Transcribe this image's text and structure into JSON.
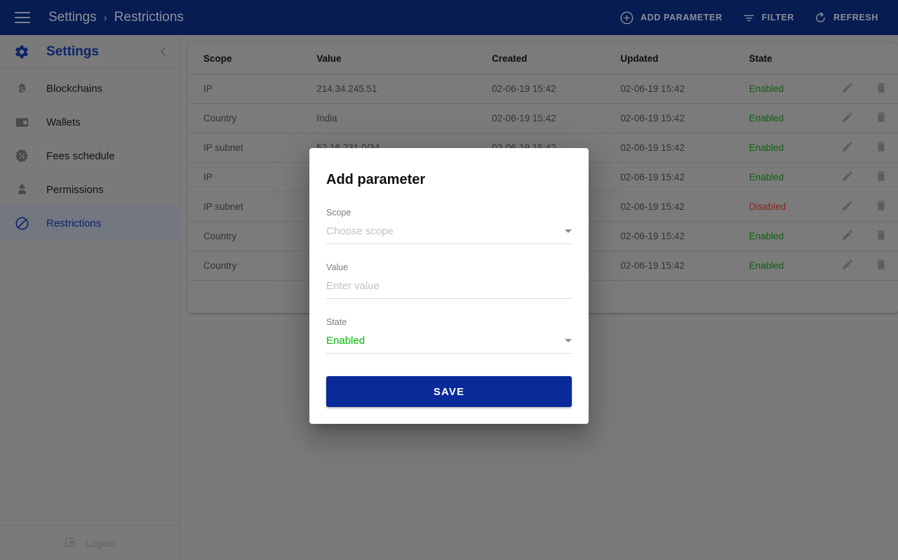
{
  "topbar": {
    "menu_icon": "hamburger-icon",
    "breadcrumb": {
      "root": "Settings",
      "separator": "›",
      "current": "Restrictions"
    },
    "actions": [
      {
        "icon": "plus-circle-icon",
        "label": "ADD PARAMETER"
      },
      {
        "icon": "filter-icon",
        "label": "FILTER"
      },
      {
        "icon": "refresh-icon",
        "label": "REFRESH"
      }
    ],
    "bg_color": "#0a2a7a",
    "text_color": "#ccd3e3"
  },
  "sidebar": {
    "header": {
      "icon": "gear-icon",
      "title": "Settings",
      "collapse_icon": "chevron-left-icon"
    },
    "items": [
      {
        "icon": "bitcoin-icon",
        "label": "Blockchains",
        "active": false
      },
      {
        "icon": "wallet-icon",
        "label": "Wallets",
        "active": false
      },
      {
        "icon": "percent-badge-icon",
        "label": "Fees schedule",
        "active": false
      },
      {
        "icon": "user-helmet-icon",
        "label": "Permissions",
        "active": false
      },
      {
        "icon": "block-circle-icon",
        "label": "Restrictions",
        "active": true
      }
    ],
    "logout": {
      "icon": "logout-icon",
      "label": "Logout"
    },
    "active_color": "#11379e"
  },
  "table": {
    "columns": [
      "Scope",
      "Value",
      "Created",
      "Updated",
      "State",
      "",
      ""
    ],
    "row_icons": {
      "edit": "pencil-icon",
      "delete": "trash-icon"
    },
    "state_colors": {
      "Enabled": "#1d8a1d",
      "Disabled": "#c0392b"
    },
    "rows": [
      {
        "scope": "IP",
        "value": "214.34.245.51",
        "created": "02-06-19 15:42",
        "updated": "02-06-19 15:42",
        "state": "Enabled"
      },
      {
        "scope": "Country",
        "value": "India",
        "created": "02-06-19 15:42",
        "updated": "02-06-19 15:42",
        "state": "Enabled"
      },
      {
        "scope": "IP subnet",
        "value": "52.16.231.0/34",
        "created": "02-06-19 15:42",
        "updated": "02-06-19 15:42",
        "state": "Enabled"
      },
      {
        "scope": "IP",
        "value": "",
        "created": "",
        "updated": "02-06-19 15:42",
        "state": "Enabled"
      },
      {
        "scope": "IP subnet",
        "value": "",
        "created": "",
        "updated": "02-06-19 15:42",
        "state": "Disabled"
      },
      {
        "scope": "Country",
        "value": "",
        "created": "",
        "updated": "02-06-19 15:42",
        "state": "Enabled"
      },
      {
        "scope": "Country",
        "value": "",
        "created": "",
        "updated": "02-06-19 15:42",
        "state": "Enabled"
      }
    ]
  },
  "modal": {
    "title": "Add parameter",
    "scope": {
      "label": "Scope",
      "placeholder": "Choose scope",
      "value": "",
      "caret_icon": "caret-down-icon"
    },
    "value": {
      "label": "Value",
      "placeholder": "Enter value",
      "value": ""
    },
    "state": {
      "label": "State",
      "value": "Enabled",
      "caret_icon": "caret-down-icon",
      "value_color": "#00bb00"
    },
    "save_label": "SAVE",
    "save_color": "#0a2a9a"
  }
}
